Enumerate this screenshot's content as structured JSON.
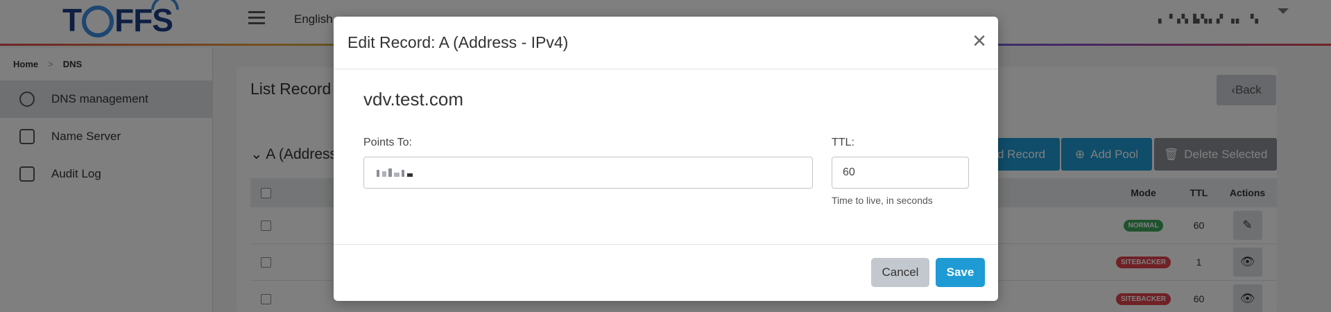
{
  "app": {
    "logo_text_left": "T",
    "logo_text_right": "FFS",
    "language": "English",
    "user_label": "▖▝▗▚ ▙▚▖▞ ▗▖ ▝▖"
  },
  "breadcrumb": {
    "home": "Home",
    "separator": ">",
    "current": "DNS"
  },
  "sidebar": {
    "items": [
      {
        "label": "DNS management",
        "icon": "dashboard-gauge-icon",
        "active": true
      },
      {
        "label": "Name Server",
        "icon": "document-list-icon",
        "active": false
      },
      {
        "label": "Audit Log",
        "icon": "edit-log-icon",
        "active": false
      }
    ]
  },
  "main": {
    "list_title": "List Record",
    "back_label": "Back",
    "section_title": "A (Address",
    "add_record_label": "d Record",
    "add_pool_label": "Add Pool",
    "delete_selected_label": "Delete Selected",
    "table": {
      "headers": [
        "Mode",
        "TTL",
        "Actions"
      ],
      "rows": [
        {
          "name": "",
          "mode": "NORMAL",
          "mode_color": "#3ea55c",
          "ttl": "60",
          "action_icon": "edit-icon"
        },
        {
          "name": "",
          "mode": "SITEBACKER",
          "mode_color": "#e0434d",
          "ttl": "1",
          "action_icon": "eye-icon"
        },
        {
          "name": "",
          "mode": "SITEBACKER",
          "mode_color": "#e0434d",
          "ttl": "60",
          "action_icon": "eye-icon"
        }
      ]
    }
  },
  "modal": {
    "title": "Edit Record: A (Address - IPv4)",
    "close_symbol": "×",
    "domain": "vdv.test.com",
    "points_to_label": "Points To:",
    "points_to_value": "",
    "ttl_label": "TTL:",
    "ttl_value": "60",
    "ttl_hint": "Time to live, in seconds",
    "cancel_label": "Cancel",
    "save_label": "Save"
  },
  "colors": {
    "primary": "#1e9bd5",
    "cancel": "#c3c8ce",
    "normal_badge": "#3ea55c",
    "sitebacker_badge": "#e0434d"
  }
}
